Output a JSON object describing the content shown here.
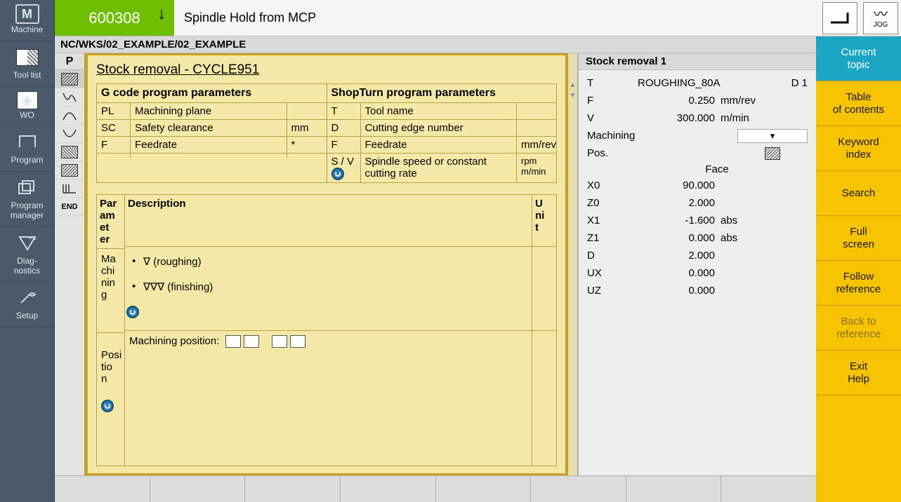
{
  "sidebar_left": {
    "items": [
      {
        "label": "Machine",
        "icon": "M"
      },
      {
        "label": "Tool list",
        "icon": "box"
      },
      {
        "label": "WO",
        "icon": "target"
      },
      {
        "label": "Program",
        "icon": "shape"
      },
      {
        "label": "Program\nmanager",
        "icon": "stack"
      },
      {
        "label": "Diag-\nnostics",
        "icon": "tri"
      },
      {
        "label": "Setup",
        "icon": "wrench"
      }
    ]
  },
  "top": {
    "code": "600308",
    "message": "Spindle Hold from MCP",
    "jog_label": "JOG"
  },
  "path": "NC/WKS/02_EXAMPLE/02_EXAMPLE",
  "program_col": {
    "head": "P",
    "items": [
      "",
      "",
      "",
      "",
      "",
      "",
      "",
      "END"
    ]
  },
  "help": {
    "title": "Stock removal - CYCLE951",
    "gcode_head": "G code program parameters",
    "shop_head": "ShopTurn program parameters",
    "gcode_rows": [
      {
        "c1": "PL",
        "c2": "Machining plane",
        "c3": ""
      },
      {
        "c1": "SC",
        "c2": "Safety clearance",
        "c3": "mm"
      },
      {
        "c1": "F",
        "c2": "Feedrate",
        "c3": "*"
      },
      {
        "c1": "",
        "c2": "",
        "c3": ""
      }
    ],
    "shop_rows": [
      {
        "c1": "T",
        "c2": "Tool name",
        "c3": ""
      },
      {
        "c1": "D",
        "c2": "Cutting edge number",
        "c3": ""
      },
      {
        "c1": "F",
        "c2": "Feedrate",
        "c3": "mm/rev"
      },
      {
        "c1": "S / V",
        "c2": "Spindle speed or constant cutting rate",
        "c3": "rpm m/min",
        "icon": true
      }
    ],
    "desc_head_c1": "Par\nam\net\ner",
    "desc_head_c2": "Description",
    "desc_head_c3": "U\nni\nt",
    "machining_label": "Ma\nchi\nnin\ng",
    "bullet1": "∇ (roughing)",
    "bullet2": "∇∇∇ (finishing)",
    "position_label": "Posi\ntio\nn",
    "position_text": "Machining position:"
  },
  "form": {
    "title": "Stock removal 1",
    "rows_top": [
      {
        "lbl": "T",
        "val": "ROUGHING_80A",
        "unit": "",
        "extra": "D 1"
      },
      {
        "lbl": "F",
        "val": "0.250",
        "unit": "mm/rev"
      },
      {
        "lbl": "V",
        "val": "300.000",
        "unit": "m/min"
      }
    ],
    "machining_label": "Machining",
    "machining_val": "▾",
    "pos_label": "Pos.",
    "face_label": "Face",
    "coords": [
      {
        "lbl": "X0",
        "val": "90.000",
        "unit": ""
      },
      {
        "lbl": "Z0",
        "val": "2.000",
        "unit": ""
      },
      {
        "lbl": "X1",
        "val": "-1.600",
        "unit": "abs"
      },
      {
        "lbl": "Z1",
        "val": "0.000",
        "unit": "abs"
      },
      {
        "lbl": "D",
        "val": "2.000",
        "unit": ""
      },
      {
        "lbl": "UX",
        "val": "0.000",
        "unit": ""
      },
      {
        "lbl": "UZ",
        "val": "0.000",
        "unit": ""
      }
    ]
  },
  "right_menu": [
    {
      "label": "Current\ntopic",
      "kind": "current"
    },
    {
      "label": "Table\nof contents",
      "kind": ""
    },
    {
      "label": "Keyword\nindex",
      "kind": ""
    },
    {
      "label": "Search",
      "kind": ""
    },
    {
      "label": "Full\nscreen",
      "kind": ""
    },
    {
      "label": "Follow\nreference",
      "kind": ""
    },
    {
      "label": "Back to\nreference",
      "kind": "disabled"
    },
    {
      "label": "Exit\nHelp",
      "kind": ""
    }
  ]
}
